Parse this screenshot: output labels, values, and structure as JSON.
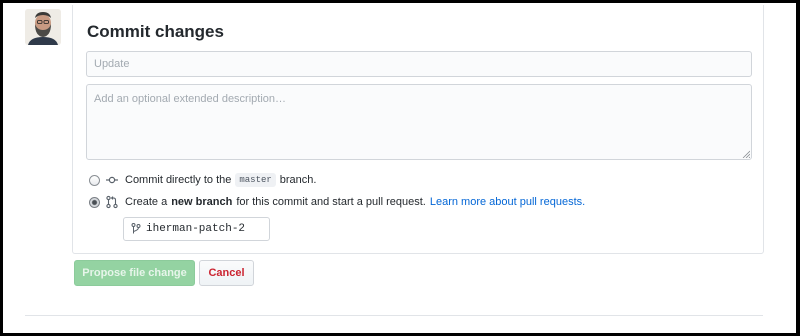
{
  "commit": {
    "title": "Commit changes",
    "summary_placeholder": "Update",
    "description_placeholder": "Add an optional extended description…",
    "option_direct": {
      "prefix": "Commit directly to the",
      "branch": "master",
      "suffix": "branch."
    },
    "option_new_branch": {
      "prefix": "Create a",
      "bold": "new branch",
      "middle": "for this commit and start a pull request.",
      "link": "Learn more about pull requests.",
      "selected": true
    },
    "branch_name": "iherman-patch-2",
    "propose_label": "Propose file change",
    "cancel_label": "Cancel"
  },
  "icons": {
    "commit": "git-commit-icon",
    "pull_request": "git-pull-request-icon",
    "branch": "git-branch-icon"
  },
  "colors": {
    "primary_button": "#94d3a2",
    "cancel_text": "#cb2431",
    "link": "#0366d6"
  }
}
